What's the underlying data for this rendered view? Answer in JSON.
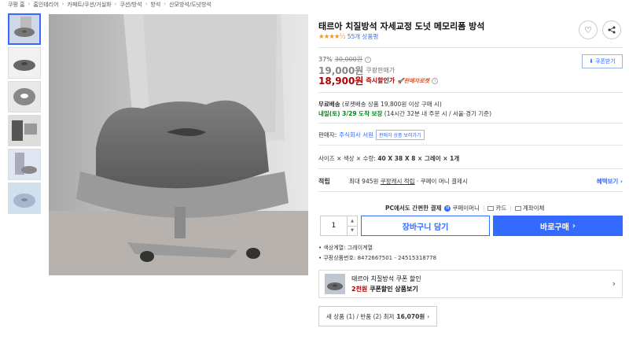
{
  "breadcrumb": [
    "쿠팡 홈",
    "홈인테리어",
    "카페트/쿠션/거실화",
    "쿠션/방석",
    "방석",
    "산모방석/도넛방석"
  ],
  "product": {
    "title": "태르아 치질방석 자세교정 도넛 메모리폼 방석",
    "stars": "★★★★½",
    "review_count": "55개 상품평"
  },
  "price": {
    "discount_rate": "37%",
    "original": "30,000원",
    "coupang_price": "19,000원",
    "coupang_price_label": "쿠팡판매가",
    "instant_price": "18,900원",
    "instant_label": "즉시할인가",
    "rocket_label": "판매자로켓",
    "coupon_btn": "쿠폰받기"
  },
  "shipping": {
    "line1_bold": "무료배송",
    "line1_rest": " (로켓배송 상품 19,800원 이상 구매 시)",
    "line2_green": "내일(토) 3/29 도착 보장",
    "line2_rest": " (14시간 32분  내 주문 시 / 서울⋅경기 기준)"
  },
  "seller": {
    "label": "판매자:",
    "name": "주식회사 서원",
    "other_btn": "판매자 상품 보러가기"
  },
  "option": {
    "label": "사이즈 × 색상 × 수량:",
    "value": "40 X 38 X 8 × 그레이 × 1개"
  },
  "reward": {
    "label": "적립",
    "text_pre": "최대 945원 ",
    "text_link": "쿠팡캐시 적립",
    "text_post": " · 쿠페이 머니 결제시",
    "more": "혜택보기 ›"
  },
  "payment": {
    "intro": "PC에서도 간편한 결제",
    "m1": "쿠페이머니",
    "m2": "카드",
    "m3": "계좌이체"
  },
  "purchase": {
    "quantity": "1",
    "cart_btn": "장바구니 담기",
    "buy_btn": "바로구매",
    "buy_arrow": "›"
  },
  "details": [
    "색상계열: 그레이계열",
    "쿠팡상품번호: 8472667501 - 24515318778"
  ],
  "promo": {
    "line1": "태르아 치질방석 쿠폰 할인",
    "line2_red": "2천원",
    "line2_rest": " 쿠폰할인 상품보기"
  },
  "new_used": {
    "text": "새 상품 (1) / 반품 (2) 최저",
    "price": "16,070원",
    "arrow": "›"
  },
  "colors": {
    "accent": "#346aff",
    "sale_red": "#ae0000",
    "delivery_green": "#00891a",
    "star": "#ff9600"
  }
}
